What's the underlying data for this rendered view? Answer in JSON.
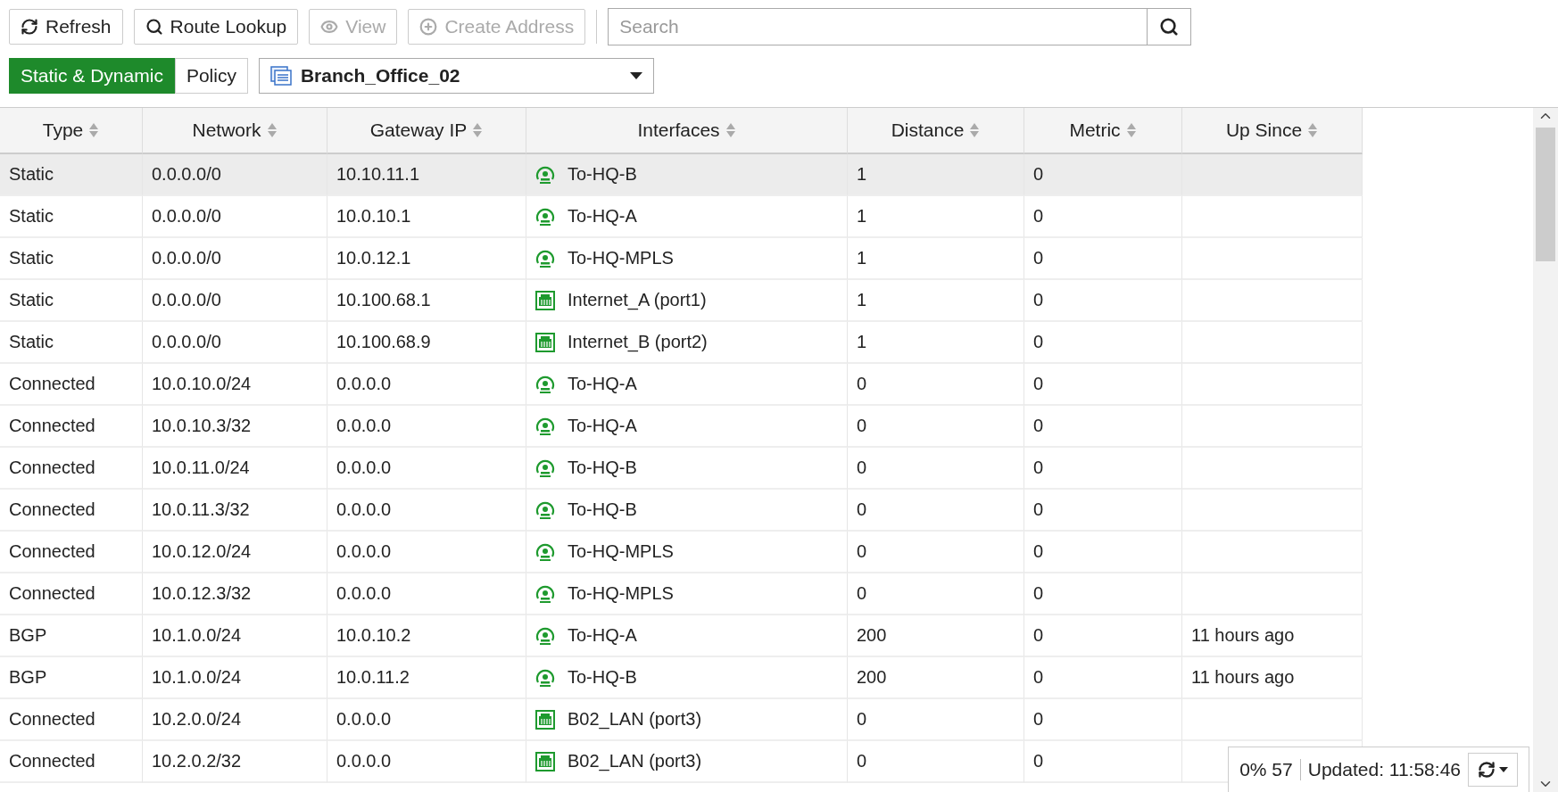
{
  "toolbar": {
    "buttons": [
      {
        "label": "Refresh",
        "kind": "refresh",
        "disabled": false
      },
      {
        "label": "Route Lookup",
        "kind": "search",
        "disabled": false
      },
      {
        "label": "View",
        "kind": "eye",
        "disabled": true
      },
      {
        "label": "Create Address",
        "kind": "plus",
        "disabled": true
      }
    ],
    "search": {
      "placeholder": "Search"
    }
  },
  "tabs": [
    {
      "label": "Static & Dynamic",
      "selected": true
    },
    {
      "label": "Policy",
      "selected": false
    }
  ],
  "vdom_select": {
    "value": "Branch_Office_02"
  },
  "table": {
    "columns": [
      "Type",
      "Network",
      "Gateway IP",
      "Interfaces",
      "Distance",
      "Metric",
      "Up Since"
    ],
    "rows": [
      {
        "selected": true,
        "cells": [
          "Static",
          "0.0.0.0/0",
          "10.10.11.1",
          "To-HQ-B",
          "1",
          "0",
          ""
        ],
        "kind": "tunnel"
      },
      {
        "selected": false,
        "cells": [
          "Static",
          "0.0.0.0/0",
          "10.0.10.1",
          "To-HQ-A",
          "1",
          "0",
          ""
        ],
        "kind": "tunnel"
      },
      {
        "selected": false,
        "cells": [
          "Static",
          "0.0.0.0/0",
          "10.0.12.1",
          "To-HQ-MPLS",
          "1",
          "0",
          ""
        ],
        "kind": "tunnel"
      },
      {
        "selected": false,
        "cells": [
          "Static",
          "0.0.0.0/0",
          "10.100.68.1",
          "Internet_A (port1)",
          "1",
          "0",
          ""
        ],
        "kind": "port"
      },
      {
        "selected": false,
        "cells": [
          "Static",
          "0.0.0.0/0",
          "10.100.68.9",
          "Internet_B (port2)",
          "1",
          "0",
          ""
        ],
        "kind": "port"
      },
      {
        "selected": false,
        "cells": [
          "Connected",
          "10.0.10.0/24",
          "0.0.0.0",
          "To-HQ-A",
          "0",
          "0",
          ""
        ],
        "kind": "tunnel"
      },
      {
        "selected": false,
        "cells": [
          "Connected",
          "10.0.10.3/32",
          "0.0.0.0",
          "To-HQ-A",
          "0",
          "0",
          ""
        ],
        "kind": "tunnel"
      },
      {
        "selected": false,
        "cells": [
          "Connected",
          "10.0.11.0/24",
          "0.0.0.0",
          "To-HQ-B",
          "0",
          "0",
          ""
        ],
        "kind": "tunnel"
      },
      {
        "selected": false,
        "cells": [
          "Connected",
          "10.0.11.3/32",
          "0.0.0.0",
          "To-HQ-B",
          "0",
          "0",
          ""
        ],
        "kind": "tunnel"
      },
      {
        "selected": false,
        "cells": [
          "Connected",
          "10.0.12.0/24",
          "0.0.0.0",
          "To-HQ-MPLS",
          "0",
          "0",
          ""
        ],
        "kind": "tunnel"
      },
      {
        "selected": false,
        "cells": [
          "Connected",
          "10.0.12.3/32",
          "0.0.0.0",
          "To-HQ-MPLS",
          "0",
          "0",
          ""
        ],
        "kind": "tunnel"
      },
      {
        "selected": false,
        "cells": [
          "BGP",
          "10.1.0.0/24",
          "10.0.10.2",
          "To-HQ-A",
          "200",
          "0",
          "11 hours ago"
        ],
        "kind": "tunnel"
      },
      {
        "selected": false,
        "cells": [
          "BGP",
          "10.1.0.0/24",
          "10.0.11.2",
          "To-HQ-B",
          "200",
          "0",
          "11 hours ago"
        ],
        "kind": "tunnel"
      },
      {
        "selected": false,
        "cells": [
          "Connected",
          "10.2.0.0/24",
          "0.0.0.0",
          "B02_LAN (port3)",
          "0",
          "0",
          ""
        ],
        "kind": "port"
      },
      {
        "selected": false,
        "cells": [
          "Connected",
          "10.2.0.2/32",
          "0.0.0.0",
          "B02_LAN (port3)",
          "0",
          "0",
          ""
        ],
        "kind": "port"
      }
    ]
  },
  "status": {
    "stats": "0% 57",
    "updated": "Updated: 11:58:46"
  }
}
